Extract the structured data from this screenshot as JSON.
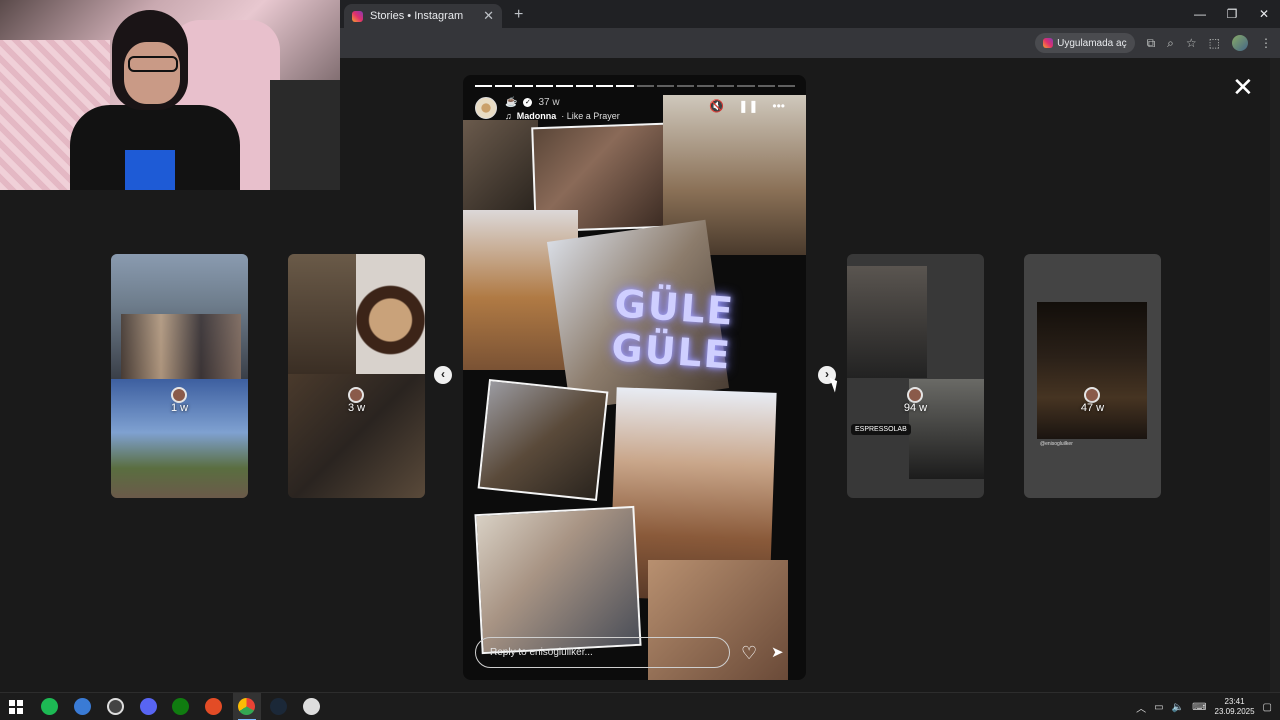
{
  "browser": {
    "tab_title": "Stories • Instagram",
    "tab_close": "✕",
    "new_tab": "+",
    "open_in_app": "Uygulamada aç",
    "win_min": "—",
    "win_max": "❐",
    "win_close": "✕"
  },
  "story": {
    "time": "37 w",
    "music_artist": "Madonna",
    "music_song": "· Like a Prayer",
    "overlay_text": "GÜLE GÜLE",
    "reply_placeholder": "Reply to enisogluilker...",
    "progress_total": 16,
    "progress_done": 8
  },
  "previews": [
    {
      "age": "1 w"
    },
    {
      "age": "3 w"
    },
    {
      "age": "94 w",
      "tag": "ESPRESSOLAB"
    },
    {
      "age": "47 w",
      "handle": "@enisogluilker"
    }
  ],
  "taskbar": {
    "time": "23:41",
    "date": "23.09.2025"
  }
}
